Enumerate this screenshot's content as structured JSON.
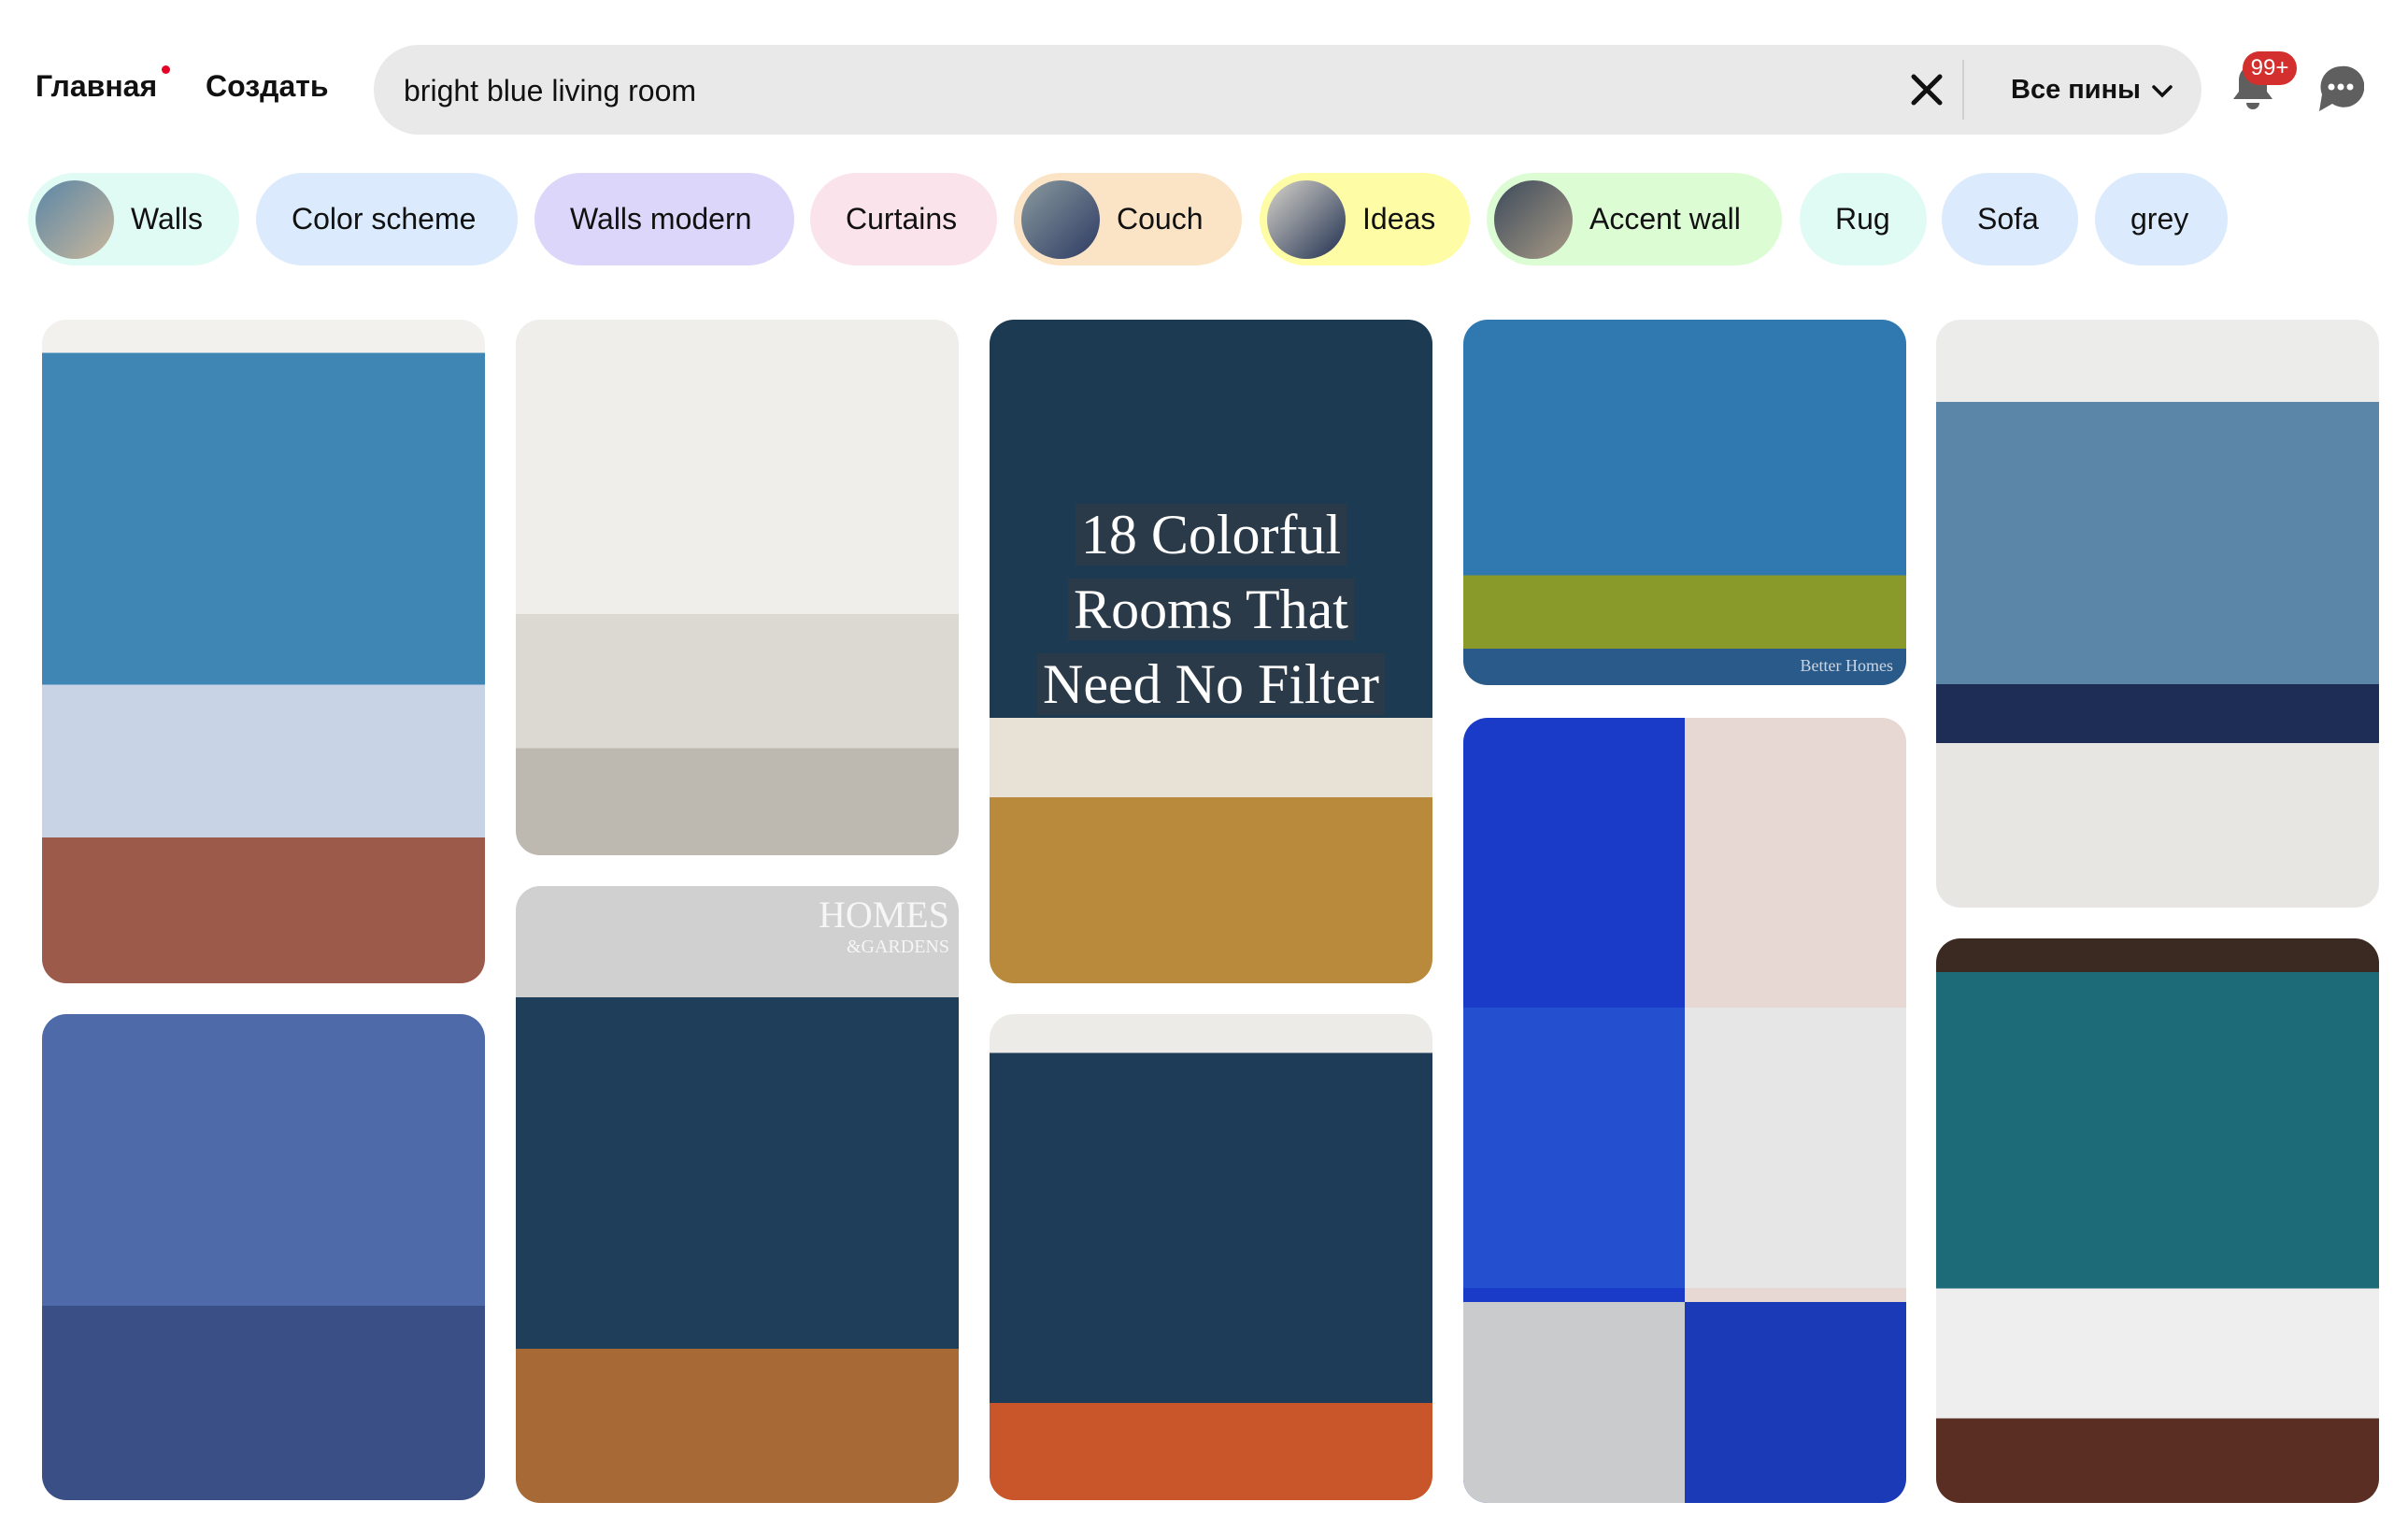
{
  "header": {
    "nav_home": "Главная",
    "nav_create": "Создать",
    "search_value": "bright blue living room",
    "filter_label": "Все пины",
    "notifications_badge": "99+",
    "accent_color": "#e60023"
  },
  "chips": [
    {
      "label": "Walls",
      "color": "#e0fbf3",
      "thumb": true
    },
    {
      "label": "Color scheme",
      "color": "#dbeafc",
      "thumb": false
    },
    {
      "label": "Walls modern",
      "color": "#dcd6fa",
      "thumb": false
    },
    {
      "label": "Curtains",
      "color": "#fae3ea",
      "thumb": false
    },
    {
      "label": "Couch",
      "color": "#fbe4c6",
      "thumb": true
    },
    {
      "label": "Ideas",
      "color": "#fefca4",
      "thumb": true
    },
    {
      "label": "Accent wall",
      "color": "#dcfdd4",
      "thumb": true
    },
    {
      "label": "Rug",
      "color": "#e0fbf3",
      "thumb": false
    },
    {
      "label": "Sofa",
      "color": "#dbeafc",
      "thumb": false
    },
    {
      "label": "grey",
      "color": "#dbeafc",
      "thumb": false
    }
  ],
  "pins": {
    "overlay_title": [
      "18 Colorful",
      "Rooms That",
      "Need No Filter"
    ],
    "watermark_homes": "HOMES",
    "watermark_gardens": "&GARDENS",
    "watermark_bh": "Better Homes"
  }
}
